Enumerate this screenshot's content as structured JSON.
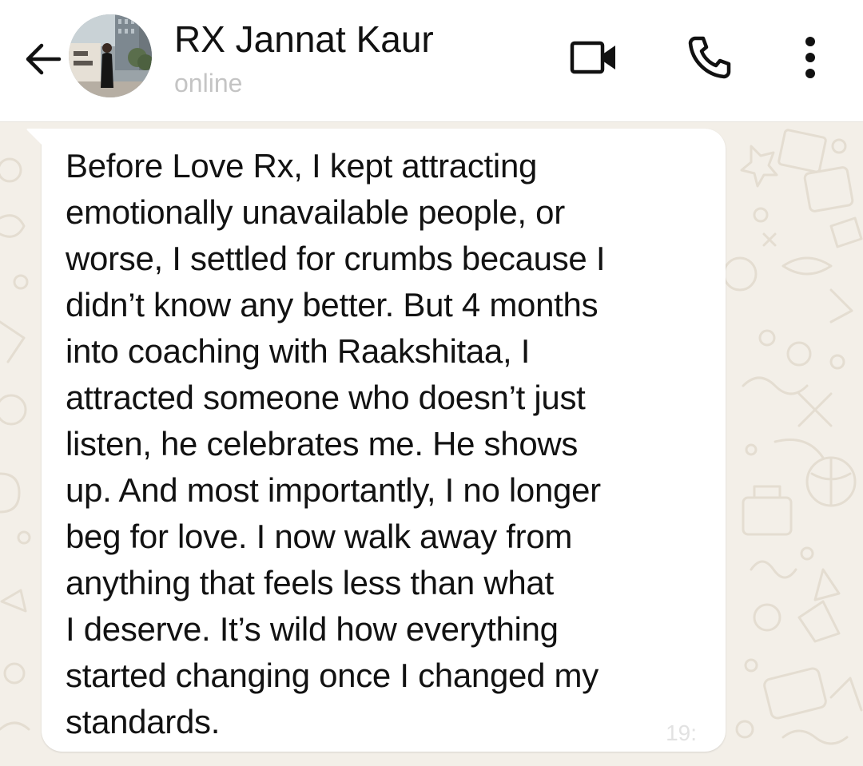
{
  "header": {
    "contact_name": "RX Jannat Kaur",
    "status": "online",
    "icons": {
      "back": "arrow-left-icon",
      "video": "video-camera-icon",
      "call": "phone-icon",
      "menu": "more-vertical-icon"
    }
  },
  "message": {
    "text": "Before Love Rx, I kept attracting\nemotionally unavailable people, or\nworse, I settled for crumbs because I\ndidn’t know any better. But 4 months\ninto coaching with Raakshitaa, I\nattracted someone who doesn’t just\nlisten, he celebrates me. He shows\nup. And most importantly, I no longer\nbeg for love. I now walk away from\nanything that feels less than what\nI deserve. It’s wild how everything\nstarted changing once I changed my\nstandards.",
    "time": "19:"
  },
  "colors": {
    "header_bg": "#ffffff",
    "chat_wallpaper": "#f3efe8",
    "bubble_bg": "#ffffff",
    "status_text": "#c4c4c4"
  }
}
